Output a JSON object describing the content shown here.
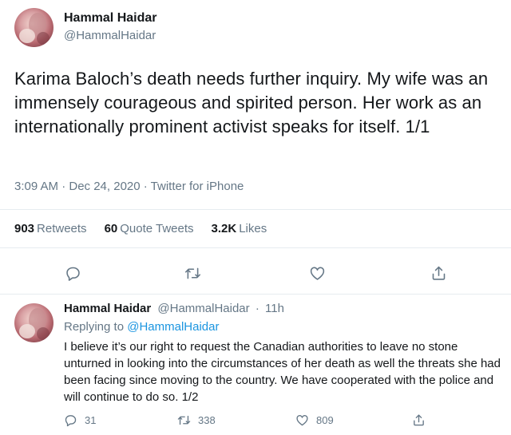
{
  "main_tweet": {
    "author_name": "Hammal Haidar",
    "author_handle": "@HammalHaidar",
    "text": "Karima Baloch’s death needs further inquiry. My wife was an immensely courageous and spirited person. Her work as an internationally prominent activist speaks for itself. 1/1",
    "meta": "3:09 AM · Dec 24, 2020 · Twitter for iPhone",
    "stats": [
      {
        "count": "903",
        "label": "Retweets"
      },
      {
        "count": "60",
        "label": "Quote Tweets"
      },
      {
        "count": "3.2K",
        "label": "Likes"
      }
    ],
    "actions": [
      {
        "icon": "reply-icon"
      },
      {
        "icon": "retweet-icon"
      },
      {
        "icon": "like-icon"
      },
      {
        "icon": "share-icon"
      }
    ]
  },
  "reply_tweet": {
    "author_name": "Hammal Haidar",
    "author_handle": "@HammalHaidar",
    "separator": "·",
    "time": "11h",
    "replying_prefix": "Replying to",
    "replying_to": "@HammalHaidar",
    "text": "I believe it’s our right to request the Canadian authorities to leave no stone unturned in looking into the circumstances of her death as well the threats she had been facing since moving to the country. We have cooperated with the police and will continue to do so. 1/2",
    "actions": [
      {
        "icon": "reply-icon",
        "count": "31"
      },
      {
        "icon": "retweet-icon",
        "count": "338"
      },
      {
        "icon": "like-icon",
        "count": "809"
      },
      {
        "icon": "share-icon",
        "count": ""
      }
    ]
  },
  "colors": {
    "text_primary": "#14171a",
    "text_secondary": "#657786",
    "link": "#1b95e0",
    "divider": "#e6ecf0"
  }
}
